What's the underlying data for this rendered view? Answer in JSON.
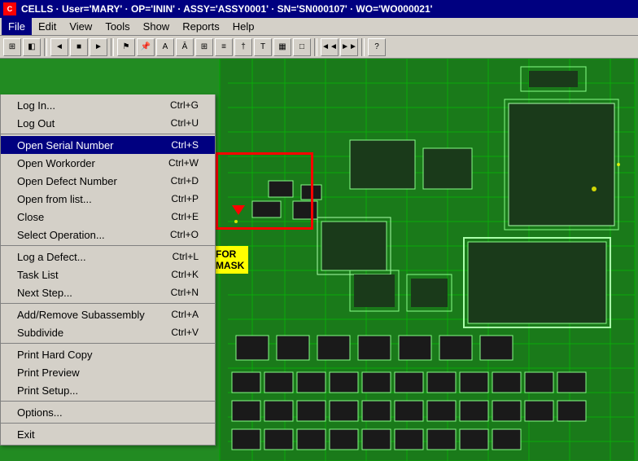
{
  "titleBar": {
    "appName": "CELLS",
    "userInfo": "User='MARY'",
    "opInfo": "OP='ININ'",
    "assyInfo": "ASSY='ASSY0001'",
    "snInfo": "SN='SN000107'",
    "woInfo": "WO='WO000021'",
    "fullTitle": "CELLS · User='MARY' · OP='ININ' · ASSY='ASSY0001' · SN='SN000107' · WO='WO000021'"
  },
  "menuBar": {
    "items": [
      {
        "id": "file",
        "label": "File",
        "active": true
      },
      {
        "id": "edit",
        "label": "Edit"
      },
      {
        "id": "view",
        "label": "View"
      },
      {
        "id": "tools",
        "label": "Tools"
      },
      {
        "id": "show",
        "label": "Show"
      },
      {
        "id": "reports",
        "label": "Reports"
      },
      {
        "id": "help",
        "label": "Help"
      }
    ]
  },
  "fileMenu": {
    "sections": [
      {
        "items": [
          {
            "label": "Log In...",
            "shortcut": "Ctrl+G"
          },
          {
            "label": "Log Out",
            "shortcut": "Ctrl+U"
          }
        ]
      },
      {
        "items": [
          {
            "label": "Open Serial Number",
            "shortcut": "Ctrl+S",
            "highlighted": true
          },
          {
            "label": "Open Workorder",
            "shortcut": "Ctrl+W"
          },
          {
            "label": "Open Defect Number",
            "shortcut": "Ctrl+D"
          },
          {
            "label": "Open from list...",
            "shortcut": "Ctrl+P"
          },
          {
            "label": "Close",
            "shortcut": "Ctrl+E"
          },
          {
            "label": "Select Operation...",
            "shortcut": "Ctrl+O"
          }
        ]
      },
      {
        "items": [
          {
            "label": "Log a Defect...",
            "shortcut": "Ctrl+L"
          },
          {
            "label": "Task List",
            "shortcut": "Ctrl+K"
          },
          {
            "label": "Next Step...",
            "shortcut": "Ctrl+N"
          }
        ]
      },
      {
        "items": [
          {
            "label": "Add/Remove Subassembly",
            "shortcut": "Ctrl+A"
          },
          {
            "label": "Subdivide",
            "shortcut": "Ctrl+V"
          }
        ]
      },
      {
        "items": [
          {
            "label": "Print Hard Copy",
            "shortcut": ""
          },
          {
            "label": "Print Preview",
            "shortcut": ""
          },
          {
            "label": "Print Setup...",
            "shortcut": ""
          }
        ]
      },
      {
        "items": [
          {
            "label": "Options...",
            "shortcut": ""
          }
        ]
      },
      {
        "items": [
          {
            "label": "Exit",
            "shortcut": ""
          }
        ]
      }
    ]
  },
  "overlay": {
    "yellowLabelLine1": "FOR",
    "yellowLabelLine2": "MASK",
    "yellowLabelText": "FOR\nMASK"
  }
}
